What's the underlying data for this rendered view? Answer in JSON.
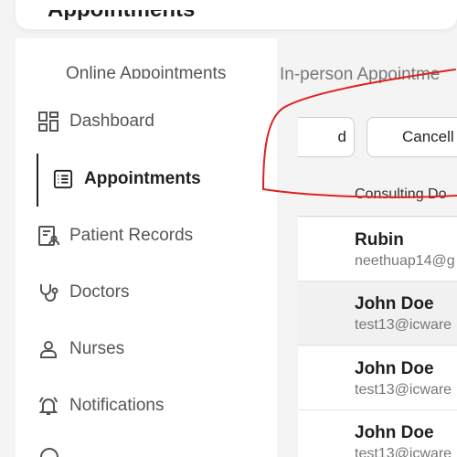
{
  "header": {
    "title": "Appointments"
  },
  "tabs": {
    "online": "Online Appointments",
    "in_person": "In-person Appointme"
  },
  "sidebar": {
    "items": [
      {
        "label": "Dashboard",
        "icon": "dashboard-icon"
      },
      {
        "label": "Appointments",
        "icon": "list-icon",
        "active": true
      },
      {
        "label": "Patient Records",
        "icon": "patient-records-icon"
      },
      {
        "label": "Doctors",
        "icon": "stethoscope-icon"
      },
      {
        "label": "Nurses",
        "icon": "user-icon"
      },
      {
        "label": "Notifications",
        "icon": "bell-icon"
      }
    ]
  },
  "filters": {
    "left_button": "d",
    "cancel_button": "Cancell"
  },
  "table": {
    "column_header": "Consulting Do",
    "rows": [
      {
        "name": "Rubin",
        "email": "neethuap14@g"
      },
      {
        "name": "John Doe",
        "email": "test13@icware"
      },
      {
        "name": "John Doe",
        "email": "test13@icware"
      },
      {
        "name": "John Doe",
        "email": "test13@icware"
      }
    ]
  },
  "colors": {
    "annotation_stroke": "#e02020",
    "active_bar": "#222222"
  }
}
